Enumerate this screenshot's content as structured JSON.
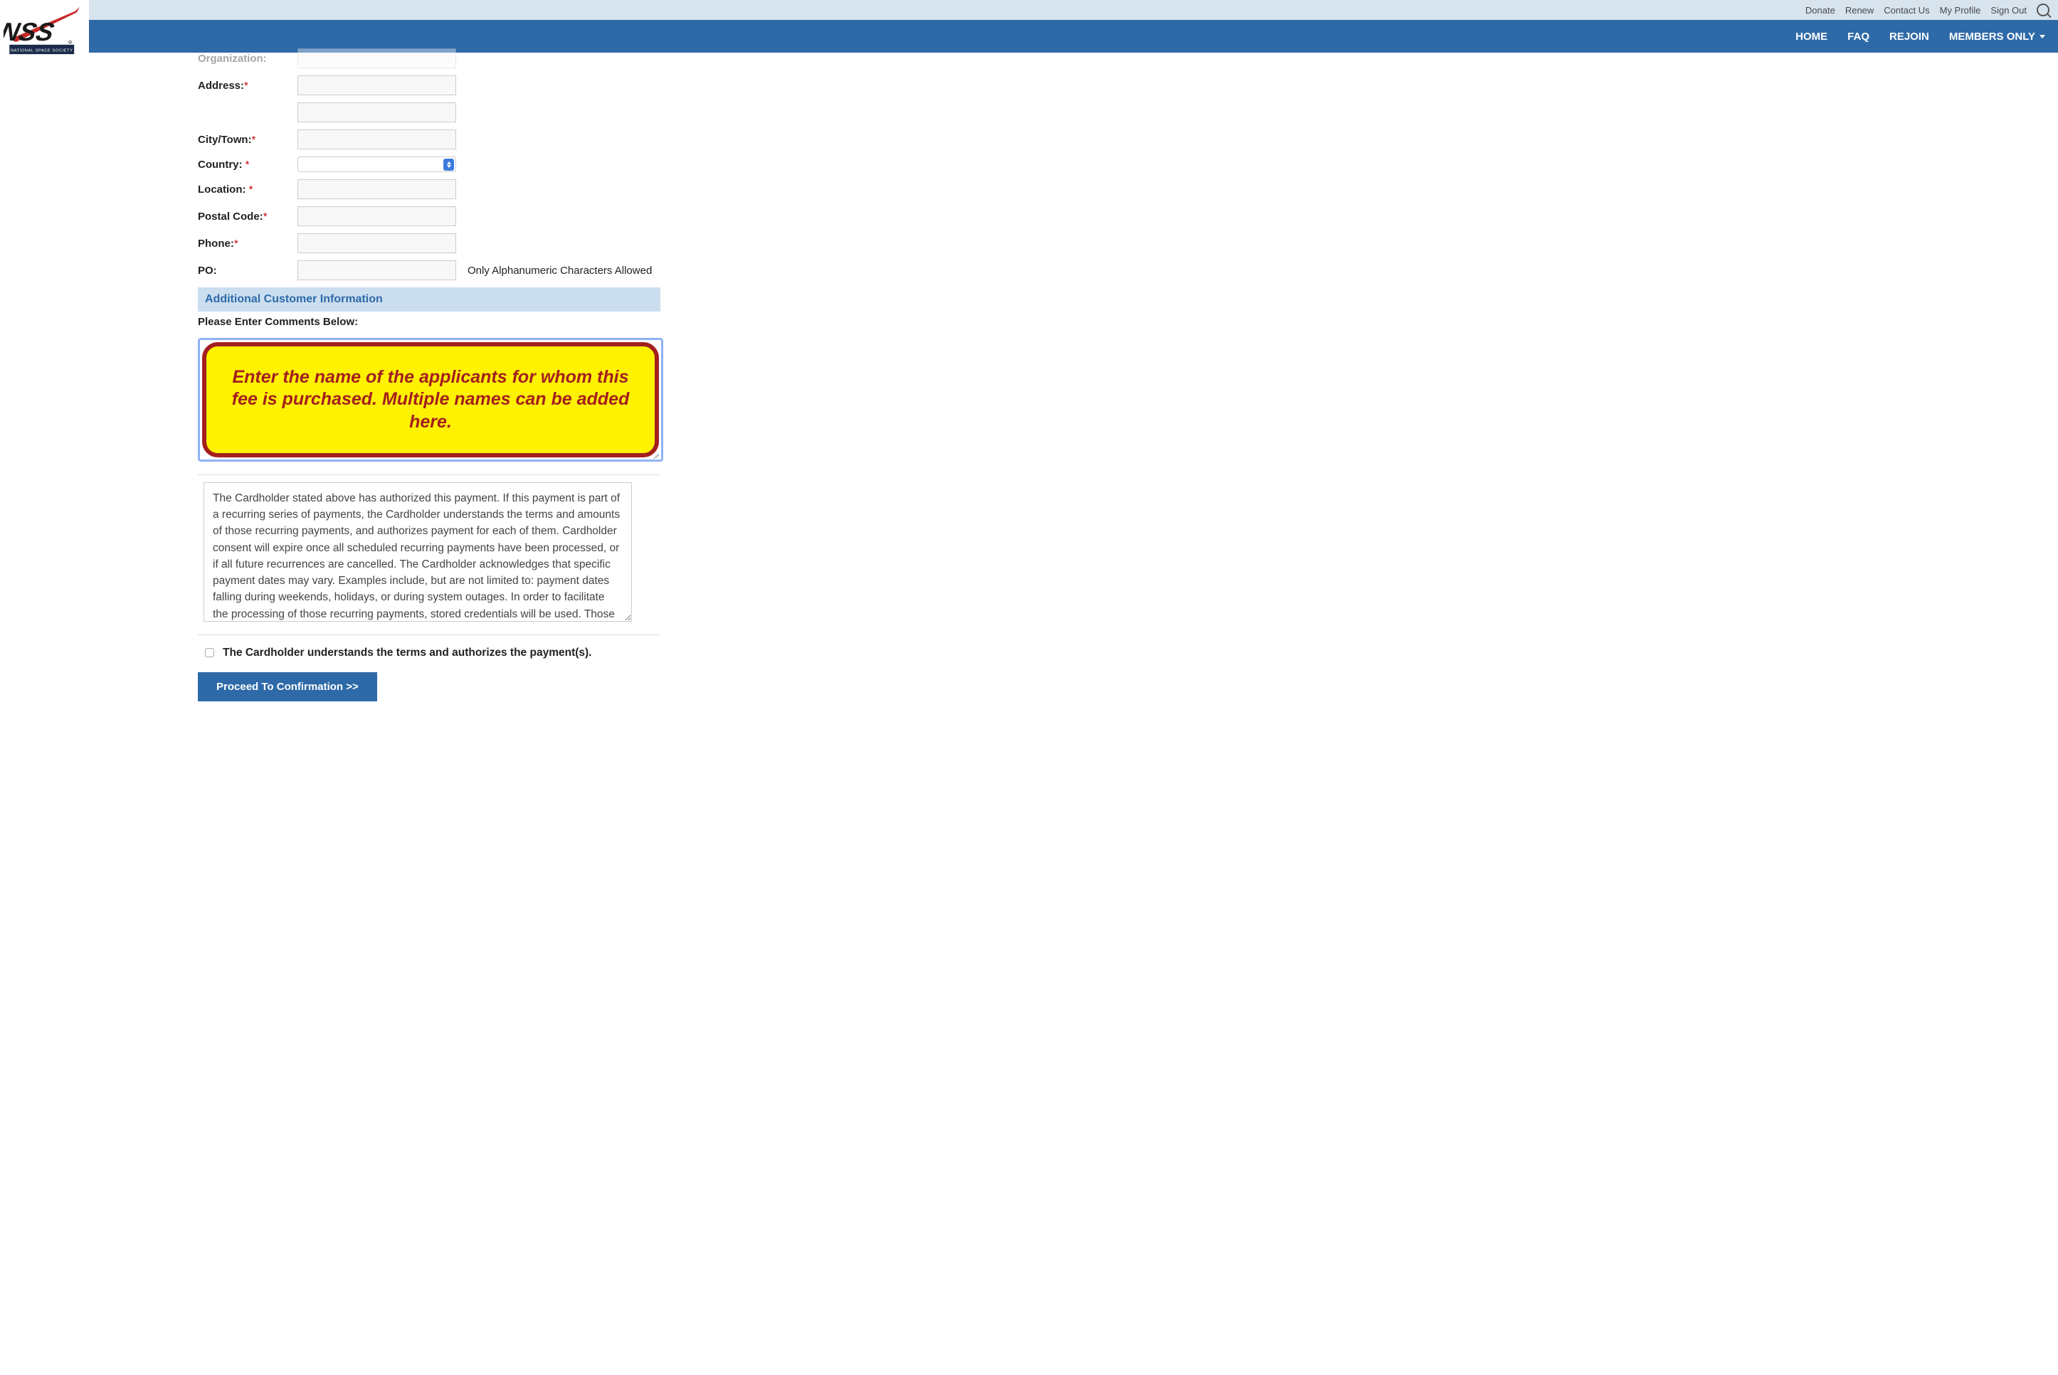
{
  "topnav": {
    "donate": "Donate",
    "renew": "Renew",
    "contact": "Contact Us",
    "profile": "My Profile",
    "signout": "Sign Out"
  },
  "mainnav": {
    "home": "HOME",
    "faq": "FAQ",
    "rejoin": "REJOIN",
    "members": "MEMBERS ONLY"
  },
  "logo": {
    "line1": "NSS",
    "tagline": "NATIONAL SPACE SOCIETY"
  },
  "form": {
    "organization_label": "Organization:",
    "address_label": "Address:",
    "city_label": "City/Town:",
    "country_label": "Country: ",
    "location_label": "Location: ",
    "postal_label": "Postal Code:",
    "phone_label": "Phone:",
    "po_label": "PO:",
    "po_hint": "Only Alphanumeric Characters Allowed"
  },
  "section": {
    "additional_header": "Additional Customer Information",
    "comments_label": "Please Enter Comments Below:"
  },
  "callout": {
    "text": "Enter the name of the applicants for whom this fee is purchased. Multiple names can be added here."
  },
  "terms": {
    "text": "The Cardholder stated above has authorized this payment. If this payment is part of a recurring series of payments, the Cardholder understands the terms and amounts of those recurring payments, and authorizes payment for each of them. Cardholder consent will expire once all scheduled recurring payments have been processed, or if all future recurrences are cancelled. The Cardholder acknowledges that specific payment dates may vary. Examples include, but are not limited to: payment dates falling during weekends, holidays, or during system outages. In order to facilitate the processing of those recurring payments, stored credentials will be used. Those stored credentials will only be used to"
  },
  "consent": {
    "label": "The Cardholder understands the terms and authorizes the payment(s)."
  },
  "button": {
    "proceed": "Proceed To Confirmation >>"
  }
}
